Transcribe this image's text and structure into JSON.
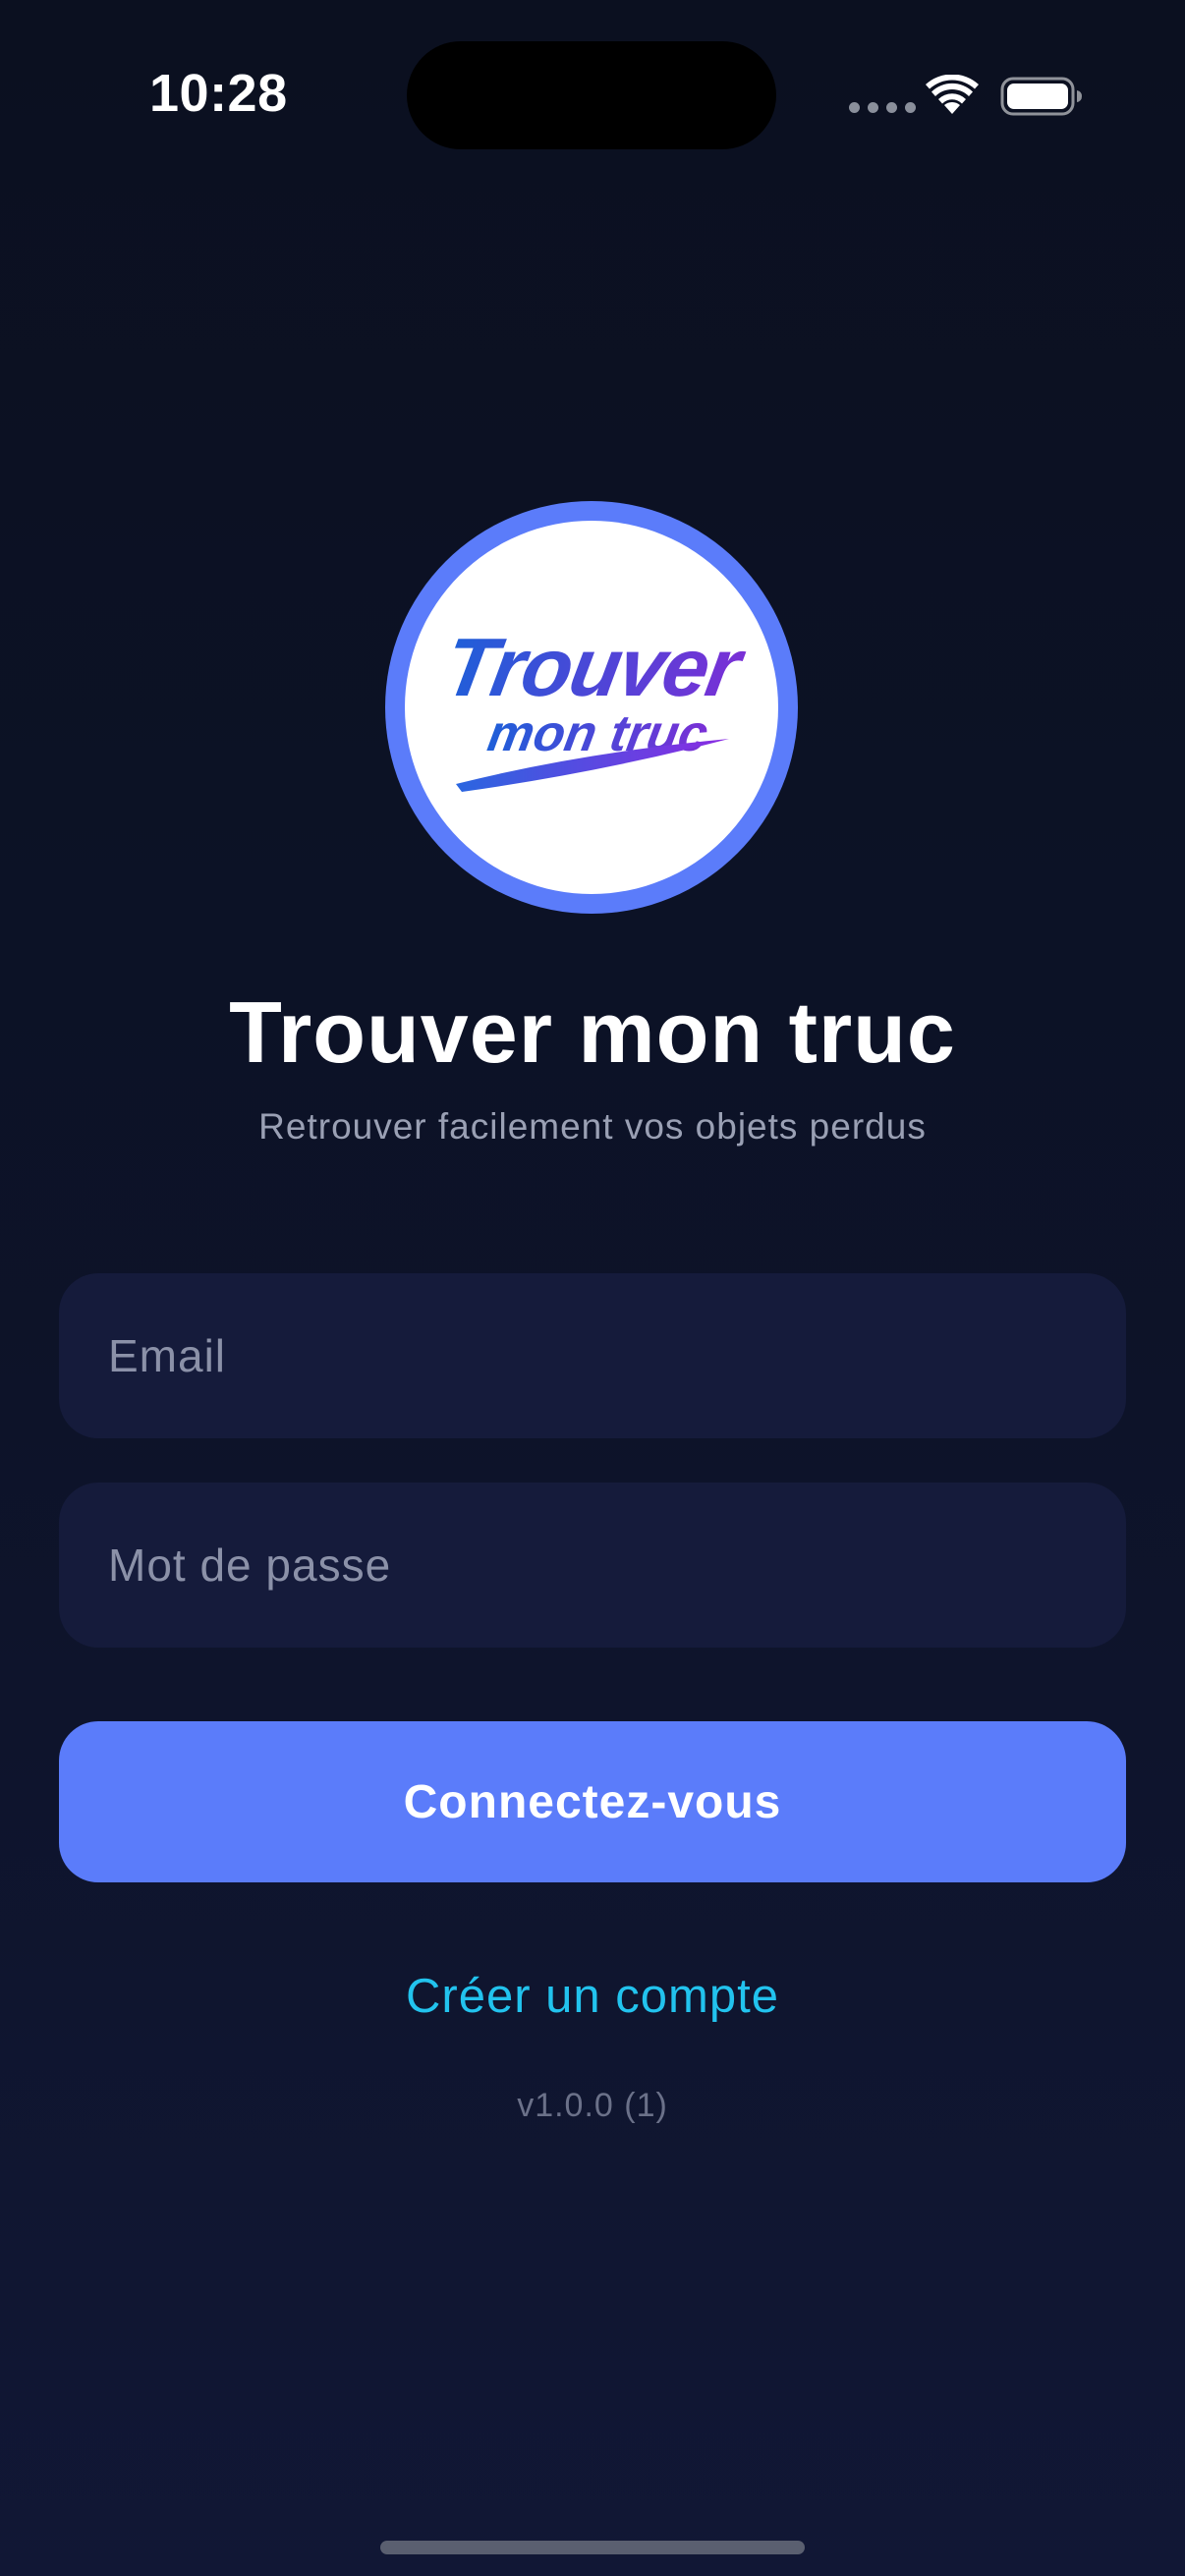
{
  "status_bar": {
    "time": "10:28",
    "icons": [
      "cellular-signal-icon",
      "wifi-icon",
      "battery-icon"
    ]
  },
  "logo": {
    "icon": "app-logo-icon",
    "line1": "Trouver",
    "line2": "mon truc",
    "ring_color": "#5b7cfa"
  },
  "header": {
    "title": "Trouver mon truc",
    "subtitle": "Retrouver facilement vos objets perdus"
  },
  "form": {
    "email_placeholder": "Email",
    "email_value": "",
    "password_placeholder": "Mot de passe",
    "password_value": "",
    "login_label": "Connectez-vous"
  },
  "links": {
    "create_account": "Créer un compte"
  },
  "footer": {
    "version": "v1.0.0 (1)"
  },
  "colors": {
    "background": "#0d1329",
    "field_background": "#151b3b",
    "accent": "#5b7cfa",
    "link": "#22c3ee"
  }
}
